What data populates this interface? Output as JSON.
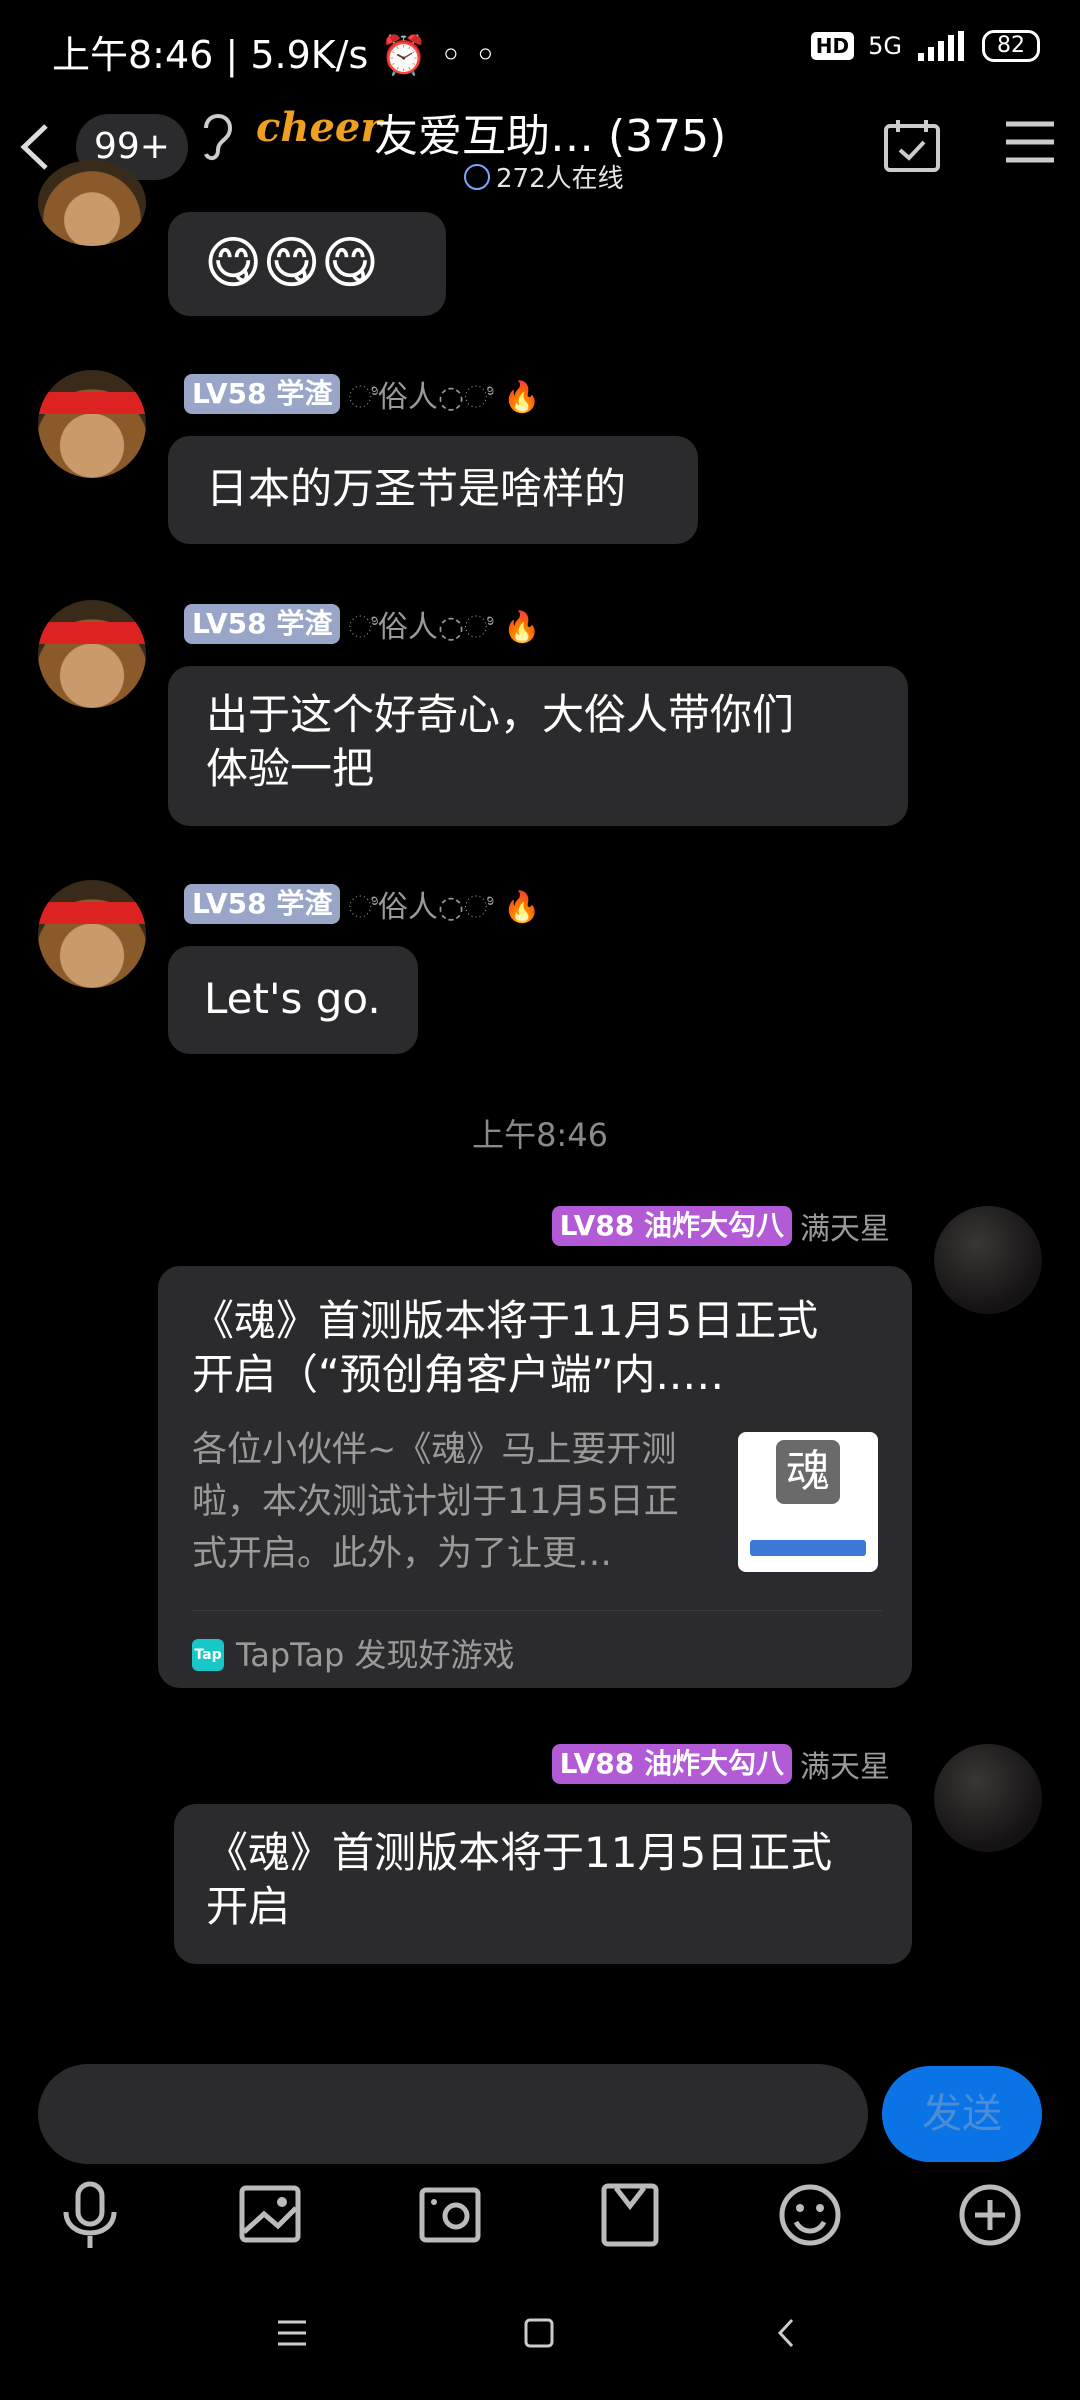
{
  "status_bar": {
    "time": "上午8:46",
    "speed": "5.9K/s",
    "hd": "HD",
    "network": "5G",
    "battery": "82"
  },
  "header": {
    "unread_badge": "99+",
    "group_prefix": "cheer",
    "title": "友爱互助… (375)",
    "online": "272人在线"
  },
  "colors": {
    "bubble": "#2b2b2d",
    "accent": "#0a74e6",
    "lv_blue": "#9aa6c8",
    "lv_purple": "#b35ad6"
  },
  "messages": [
    {
      "type": "emoji",
      "text": "😋😋😋"
    },
    {
      "level": "LV58",
      "title": "学渣",
      "name": "◌ಿ俗人◌ಿ 🔥",
      "text": "日本的万圣节是啥样的"
    },
    {
      "level": "LV58",
      "title": "学渣",
      "name": "◌ಿ俗人◌ಿ 🔥",
      "text_line1": "出于这个好奇心，大俗人带你们",
      "text_line2": "体验一把"
    },
    {
      "level": "LV58",
      "title": "学渣",
      "name": "◌ಿ俗人◌ಿ 🔥",
      "text": "Let's go."
    }
  ],
  "timestamp": "上午8:46",
  "outgoing": [
    {
      "level": "LV88",
      "title": "油炸大勾八",
      "name": "满天星",
      "card": {
        "title_line1": "《魂》首测版本将于11月5日正式",
        "title_line2": "开启（“预创角客户端”内..…",
        "desc_line1": "各位小伙伴~《魂》马上要开测",
        "desc_line2": "啦，本次测试计划于11月5日正",
        "desc_line3": "式开启。此外，为了让更…",
        "thumb_char": "魂",
        "source_logo": "Tap",
        "source": "TapTap 发现好游戏"
      }
    },
    {
      "level": "LV88",
      "title": "油炸大勾八",
      "name": "满天星",
      "text_line1": "《魂》首测版本将于11月5日正式",
      "text_line2": "开启"
    }
  ],
  "input": {
    "placeholder": "",
    "send_label": "发送"
  },
  "toolbar": [
    "microphone-icon",
    "image-icon",
    "camera-icon",
    "file-icon",
    "emoji-icon",
    "plus-icon"
  ]
}
